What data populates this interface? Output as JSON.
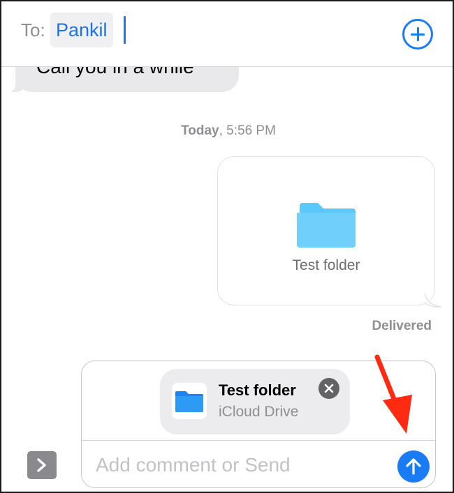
{
  "header": {
    "to_label": "To:",
    "recipient": "Pankil",
    "add_icon": "plus-circle-icon"
  },
  "conversation": {
    "previous_message": "Call you in a while",
    "timestamp_day": "Today",
    "timestamp_time": ", 5:56 PM",
    "sent_attachment": {
      "icon": "folder-icon",
      "label": "Test folder"
    },
    "status": "Delivered"
  },
  "compose": {
    "attachment": {
      "title": "Test folder",
      "subtitle": "iCloud Drive",
      "icon": "folder-icon",
      "remove_icon": "close-icon"
    },
    "placeholder": "Add comment or Send",
    "value": "",
    "expand_icon": "chevron-right-icon",
    "send_icon": "arrow-up-icon"
  },
  "annotation": {
    "icon": "red-arrow-icon",
    "color": "#ff2a12"
  },
  "colors": {
    "accent": "#1a7cf5",
    "folder": "#5ac8fa",
    "bubble_gray": "#e9e9eb"
  }
}
